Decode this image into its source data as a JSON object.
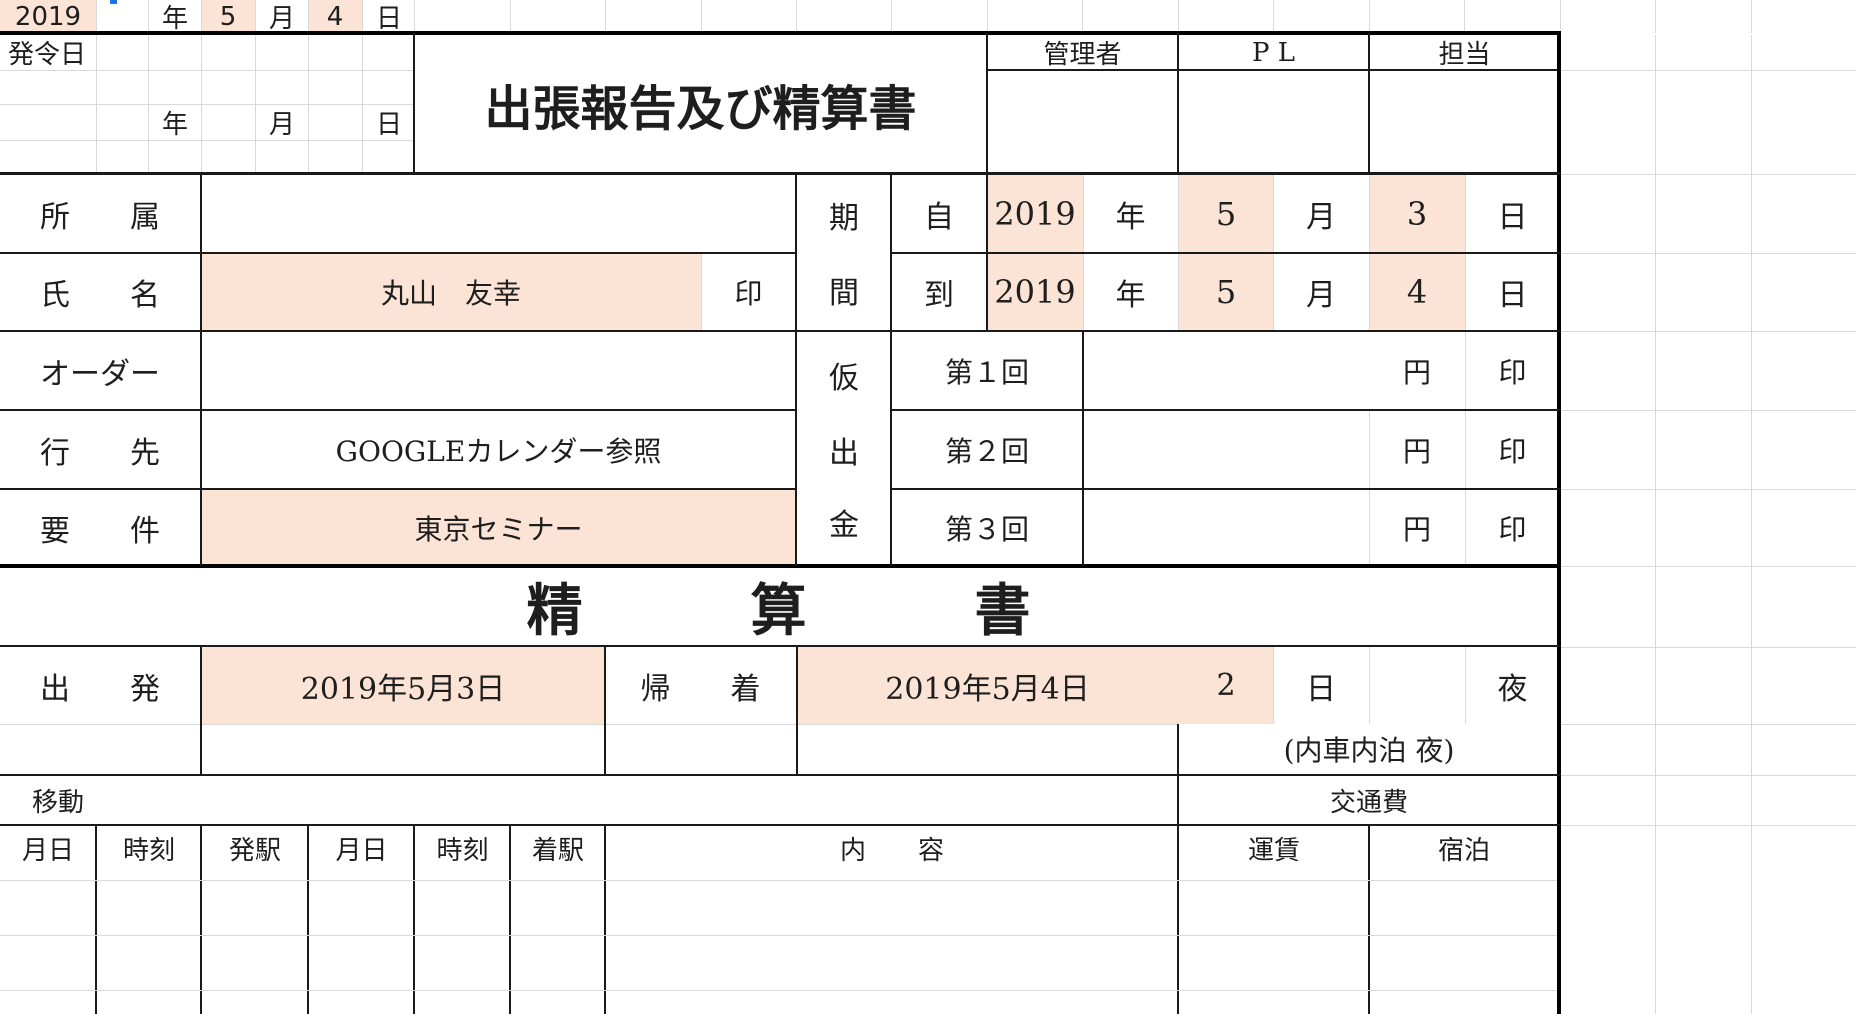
{
  "top_row": {
    "year": "2019",
    "year_unit": "年",
    "month": "5",
    "month_unit": "月",
    "day": "4",
    "day_unit": "日"
  },
  "header": {
    "hatsurei_label": "発令日",
    "date_year_unit": "年",
    "date_month_unit": "月",
    "date_day_unit": "日",
    "title": "出張報告及び精算書",
    "approvers": [
      "管理者",
      "P L",
      "担当"
    ]
  },
  "info": {
    "shozoku_label": "所　　属",
    "shozoku_value": "",
    "shimei_label": "氏　　名",
    "shimei_value": "丸山　友幸",
    "seal": "印",
    "order_label": "オーダー",
    "order_value": "",
    "ikisaki_label": "行　　先",
    "ikisaki_value": "GOOGLEカレンダー参照",
    "yoken_label": "要　　件",
    "yoken_value": "東京セミナー"
  },
  "period": {
    "label_1": "期",
    "label_2": "間",
    "from_label": "自",
    "from_year": "2019",
    "from_month": "5",
    "from_day": "3",
    "to_label": "到",
    "to_year": "2019",
    "to_month": "5",
    "to_day": "4",
    "year_unit": "年",
    "month_unit": "月",
    "day_unit": "日"
  },
  "advance": {
    "label_1": "仮",
    "label_2": "出",
    "label_3": "金",
    "rows": [
      {
        "label": "第１回",
        "amount": "",
        "unit": "円",
        "seal": "印"
      },
      {
        "label": "第２回",
        "amount": "",
        "unit": "円",
        "seal": "印"
      },
      {
        "label": "第３回",
        "amount": "",
        "unit": "円",
        "seal": "印"
      }
    ]
  },
  "settlement": {
    "title": "精　　　算　　　書",
    "depart_label": "出　　発",
    "depart_date": "2019年5月3日",
    "return_label": "帰　　着",
    "return_date": "2019年5月4日",
    "days": "2",
    "days_unit": "日",
    "nights": "",
    "nights_unit": "夜",
    "internal_note": "(内車内泊 夜)",
    "move_label": "移動",
    "transport_label": "交通費",
    "columns": [
      "月日",
      "時刻",
      "発駅",
      "月日",
      "時刻",
      "着駅",
      "内　　容",
      "運賃",
      "宿泊"
    ]
  },
  "colors": {
    "highlight": "#fbe4d5",
    "grid": "#d9d9d9",
    "border": "#000000",
    "cursor": "#1a73e8"
  }
}
